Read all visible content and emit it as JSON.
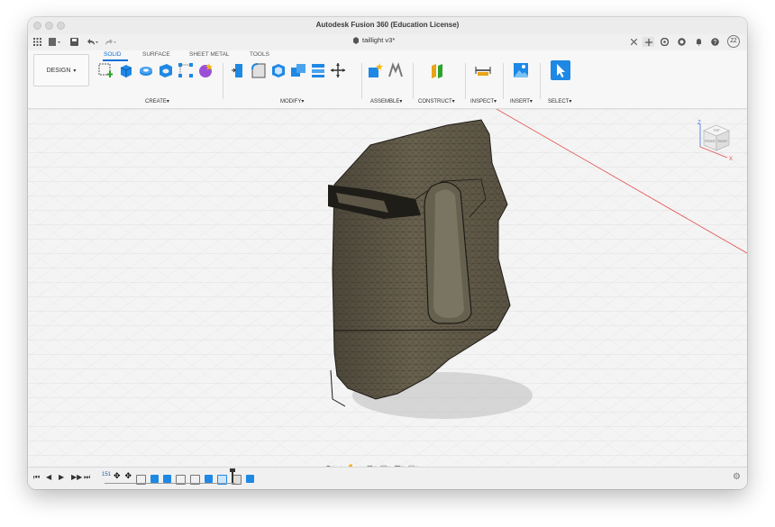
{
  "window": {
    "title": "Autodesk Fusion 360 (Education License)"
  },
  "document_tab": {
    "name": "taillight v3*"
  },
  "workspace": {
    "label": "DESIGN"
  },
  "ribbon_tabs": [
    {
      "label": "SOLID",
      "active": true
    },
    {
      "label": "SURFACE",
      "active": false
    },
    {
      "label": "SHEET METAL",
      "active": false
    },
    {
      "label": "TOOLS",
      "active": false
    }
  ],
  "tool_groups": [
    {
      "label": "CREATE"
    },
    {
      "label": "MODIFY"
    },
    {
      "label": "ASSEMBLE"
    },
    {
      "label": "CONSTRUCT"
    },
    {
      "label": "INSPECT"
    },
    {
      "label": "INSERT"
    },
    {
      "label": "SELECT"
    }
  ],
  "user": {
    "initials": "ZZ"
  },
  "viewcube": {
    "top": "TOP",
    "front": "FRONT",
    "right": "RIGHT",
    "axis_x": "X",
    "axis_z": "Z"
  },
  "timeline": {
    "feature_counter": "151"
  },
  "colors": {
    "accent": "#0b6cd6",
    "mesh": "#5c5546",
    "axis_red": "#e44c4c"
  }
}
